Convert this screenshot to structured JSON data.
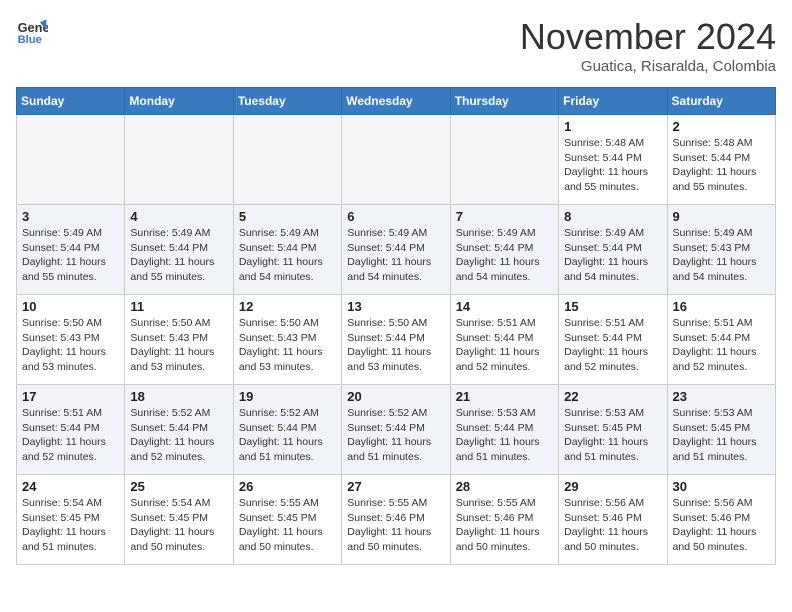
{
  "logo": {
    "line1": "General",
    "line2": "Blue"
  },
  "title": "November 2024",
  "location": "Guatica, Risaralda, Colombia",
  "weekdays": [
    "Sunday",
    "Monday",
    "Tuesday",
    "Wednesday",
    "Thursday",
    "Friday",
    "Saturday"
  ],
  "rows": [
    [
      {
        "day": "",
        "info": ""
      },
      {
        "day": "",
        "info": ""
      },
      {
        "day": "",
        "info": ""
      },
      {
        "day": "",
        "info": ""
      },
      {
        "day": "",
        "info": ""
      },
      {
        "day": "1",
        "info": "Sunrise: 5:48 AM\nSunset: 5:44 PM\nDaylight: 11 hours\nand 55 minutes."
      },
      {
        "day": "2",
        "info": "Sunrise: 5:48 AM\nSunset: 5:44 PM\nDaylight: 11 hours\nand 55 minutes."
      }
    ],
    [
      {
        "day": "3",
        "info": "Sunrise: 5:49 AM\nSunset: 5:44 PM\nDaylight: 11 hours\nand 55 minutes."
      },
      {
        "day": "4",
        "info": "Sunrise: 5:49 AM\nSunset: 5:44 PM\nDaylight: 11 hours\nand 55 minutes."
      },
      {
        "day": "5",
        "info": "Sunrise: 5:49 AM\nSunset: 5:44 PM\nDaylight: 11 hours\nand 54 minutes."
      },
      {
        "day": "6",
        "info": "Sunrise: 5:49 AM\nSunset: 5:44 PM\nDaylight: 11 hours\nand 54 minutes."
      },
      {
        "day": "7",
        "info": "Sunrise: 5:49 AM\nSunset: 5:44 PM\nDaylight: 11 hours\nand 54 minutes."
      },
      {
        "day": "8",
        "info": "Sunrise: 5:49 AM\nSunset: 5:44 PM\nDaylight: 11 hours\nand 54 minutes."
      },
      {
        "day": "9",
        "info": "Sunrise: 5:49 AM\nSunset: 5:43 PM\nDaylight: 11 hours\nand 54 minutes."
      }
    ],
    [
      {
        "day": "10",
        "info": "Sunrise: 5:50 AM\nSunset: 5:43 PM\nDaylight: 11 hours\nand 53 minutes."
      },
      {
        "day": "11",
        "info": "Sunrise: 5:50 AM\nSunset: 5:43 PM\nDaylight: 11 hours\nand 53 minutes."
      },
      {
        "day": "12",
        "info": "Sunrise: 5:50 AM\nSunset: 5:43 PM\nDaylight: 11 hours\nand 53 minutes."
      },
      {
        "day": "13",
        "info": "Sunrise: 5:50 AM\nSunset: 5:44 PM\nDaylight: 11 hours\nand 53 minutes."
      },
      {
        "day": "14",
        "info": "Sunrise: 5:51 AM\nSunset: 5:44 PM\nDaylight: 11 hours\nand 52 minutes."
      },
      {
        "day": "15",
        "info": "Sunrise: 5:51 AM\nSunset: 5:44 PM\nDaylight: 11 hours\nand 52 minutes."
      },
      {
        "day": "16",
        "info": "Sunrise: 5:51 AM\nSunset: 5:44 PM\nDaylight: 11 hours\nand 52 minutes."
      }
    ],
    [
      {
        "day": "17",
        "info": "Sunrise: 5:51 AM\nSunset: 5:44 PM\nDaylight: 11 hours\nand 52 minutes."
      },
      {
        "day": "18",
        "info": "Sunrise: 5:52 AM\nSunset: 5:44 PM\nDaylight: 11 hours\nand 52 minutes."
      },
      {
        "day": "19",
        "info": "Sunrise: 5:52 AM\nSunset: 5:44 PM\nDaylight: 11 hours\nand 51 minutes."
      },
      {
        "day": "20",
        "info": "Sunrise: 5:52 AM\nSunset: 5:44 PM\nDaylight: 11 hours\nand 51 minutes."
      },
      {
        "day": "21",
        "info": "Sunrise: 5:53 AM\nSunset: 5:44 PM\nDaylight: 11 hours\nand 51 minutes."
      },
      {
        "day": "22",
        "info": "Sunrise: 5:53 AM\nSunset: 5:45 PM\nDaylight: 11 hours\nand 51 minutes."
      },
      {
        "day": "23",
        "info": "Sunrise: 5:53 AM\nSunset: 5:45 PM\nDaylight: 11 hours\nand 51 minutes."
      }
    ],
    [
      {
        "day": "24",
        "info": "Sunrise: 5:54 AM\nSunset: 5:45 PM\nDaylight: 11 hours\nand 51 minutes."
      },
      {
        "day": "25",
        "info": "Sunrise: 5:54 AM\nSunset: 5:45 PM\nDaylight: 11 hours\nand 50 minutes."
      },
      {
        "day": "26",
        "info": "Sunrise: 5:55 AM\nSunset: 5:45 PM\nDaylight: 11 hours\nand 50 minutes."
      },
      {
        "day": "27",
        "info": "Sunrise: 5:55 AM\nSunset: 5:46 PM\nDaylight: 11 hours\nand 50 minutes."
      },
      {
        "day": "28",
        "info": "Sunrise: 5:55 AM\nSunset: 5:46 PM\nDaylight: 11 hours\nand 50 minutes."
      },
      {
        "day": "29",
        "info": "Sunrise: 5:56 AM\nSunset: 5:46 PM\nDaylight: 11 hours\nand 50 minutes."
      },
      {
        "day": "30",
        "info": "Sunrise: 5:56 AM\nSunset: 5:46 PM\nDaylight: 11 hours\nand 50 minutes."
      }
    ]
  ]
}
